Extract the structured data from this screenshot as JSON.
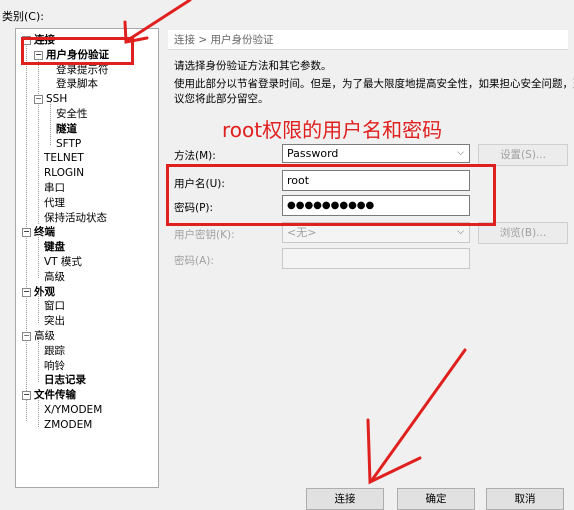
{
  "category_label": "类别(C):",
  "tree": {
    "items": [
      {
        "label": "连接",
        "bold": true,
        "twisty": "−"
      },
      {
        "label": "用户身份验证",
        "bold": true,
        "twisty": "−"
      },
      {
        "label": "登录提示符",
        "bold": false
      },
      {
        "label": "登录脚本",
        "bold": false
      },
      {
        "label": "SSH",
        "bold": false,
        "twisty": "−"
      },
      {
        "label": "安全性",
        "bold": false
      },
      {
        "label": "隧道",
        "bold": true
      },
      {
        "label": "SFTP",
        "bold": false
      },
      {
        "label": "TELNET",
        "bold": false
      },
      {
        "label": "RLOGIN",
        "bold": false
      },
      {
        "label": "串口",
        "bold": false
      },
      {
        "label": "代理",
        "bold": false
      },
      {
        "label": "保持活动状态",
        "bold": false
      },
      {
        "label": "终端",
        "bold": true,
        "twisty": "−"
      },
      {
        "label": "键盘",
        "bold": true
      },
      {
        "label": "VT 模式",
        "bold": false
      },
      {
        "label": "高级",
        "bold": false
      },
      {
        "label": "外观",
        "bold": true,
        "twisty": "−"
      },
      {
        "label": "窗口",
        "bold": false
      },
      {
        "label": "突出",
        "bold": false
      },
      {
        "label": "高级",
        "bold": false,
        "twisty": "−"
      },
      {
        "label": "跟踪",
        "bold": false
      },
      {
        "label": "响铃",
        "bold": false
      },
      {
        "label": "日志记录",
        "bold": true
      },
      {
        "label": "文件传输",
        "bold": true,
        "twisty": "−"
      },
      {
        "label": "X/YMODEM",
        "bold": false
      },
      {
        "label": "ZMODEM",
        "bold": false
      }
    ]
  },
  "breadcrumb": "连接 > 用户身份验证",
  "instructions": {
    "line1": "请选择身份验证方法和其它参数。",
    "line2": "使用此部分以节省登录时间。但是，为了最大限度地提高安全性，如果担心安全问题，建",
    "line3": "议您将此部分留空。"
  },
  "annotation": "root权限的用户名和密码",
  "form": {
    "method_label": "方法(M):",
    "method_value": "Password",
    "settings_button": "设置(S)...",
    "username_label": "用户名(U):",
    "username_value": "root",
    "password_label": "密码(P):",
    "password_value": "●●●●●●●●●●",
    "user_key_label": "用户密钥(K):",
    "user_key_value": "<无>",
    "browse_button": "浏览(B)...",
    "passphrase_label": "密码(A):"
  },
  "buttons": {
    "connect": "连接",
    "ok": "确定",
    "cancel": "取消"
  },
  "colors": {
    "annotation_red": "#e0201f"
  }
}
